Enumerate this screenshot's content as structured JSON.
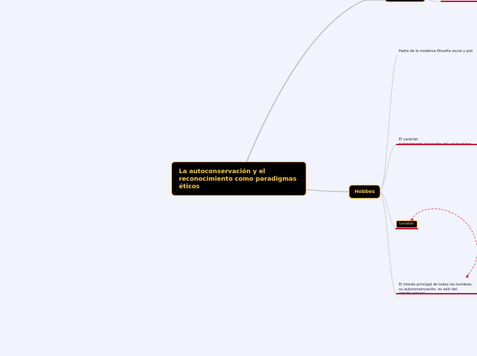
{
  "map": {
    "central": {
      "label": "La autoconservación y el reconocimiento como paradigmas éticos"
    },
    "branch": {
      "label": "Hobbes"
    },
    "subtopics": [
      {
        "label": "Padre de la moderna filosofía social y poli"
      },
      {
        "label": "El carácter\nnaturalmente insociable del ser humano"
      },
      {
        "label": "Leviatán"
      },
      {
        "label": "El interés principal de todos los hombres,\nsu autoconservación, es salir del\nestado natural"
      }
    ]
  },
  "colors": {
    "background": "#f1f3fd",
    "node_fill": "#000000",
    "node_text": "#f5c542",
    "node_border": "#f0a020",
    "connector": "#b8b8b8",
    "underline": "#c8102e",
    "relationship": "#e0304a"
  }
}
